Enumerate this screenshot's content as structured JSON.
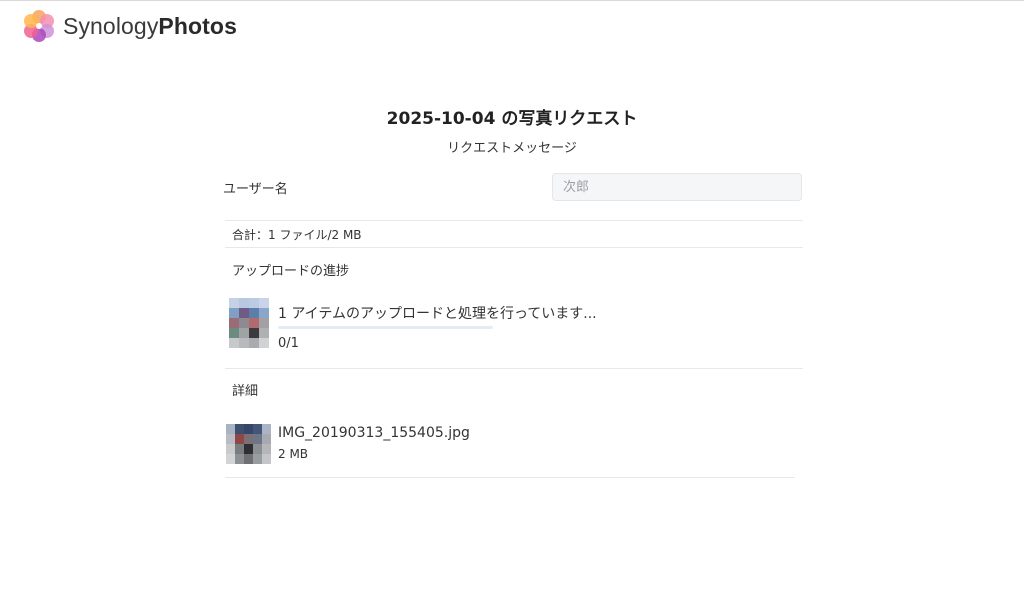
{
  "brand": {
    "name_light": "Synology",
    "name_bold": "Photos"
  },
  "request": {
    "title": "2025-10-04 の写真リクエスト",
    "message": "リクエストメッセージ"
  },
  "user_field": {
    "label": "ユーザー名",
    "placeholder": "次郎"
  },
  "summary": "合計：1 ファイル/2 MB",
  "upload": {
    "section_title": "アップロードの進捗",
    "status_text": "1 アイテムのアップロードと処理を行っています...",
    "count_text": "0/1",
    "progress": 0
  },
  "details": {
    "section_title": "詳細",
    "files": [
      {
        "name": "IMG_20190313_155405.jpg",
        "size": "2 MB"
      }
    ]
  }
}
